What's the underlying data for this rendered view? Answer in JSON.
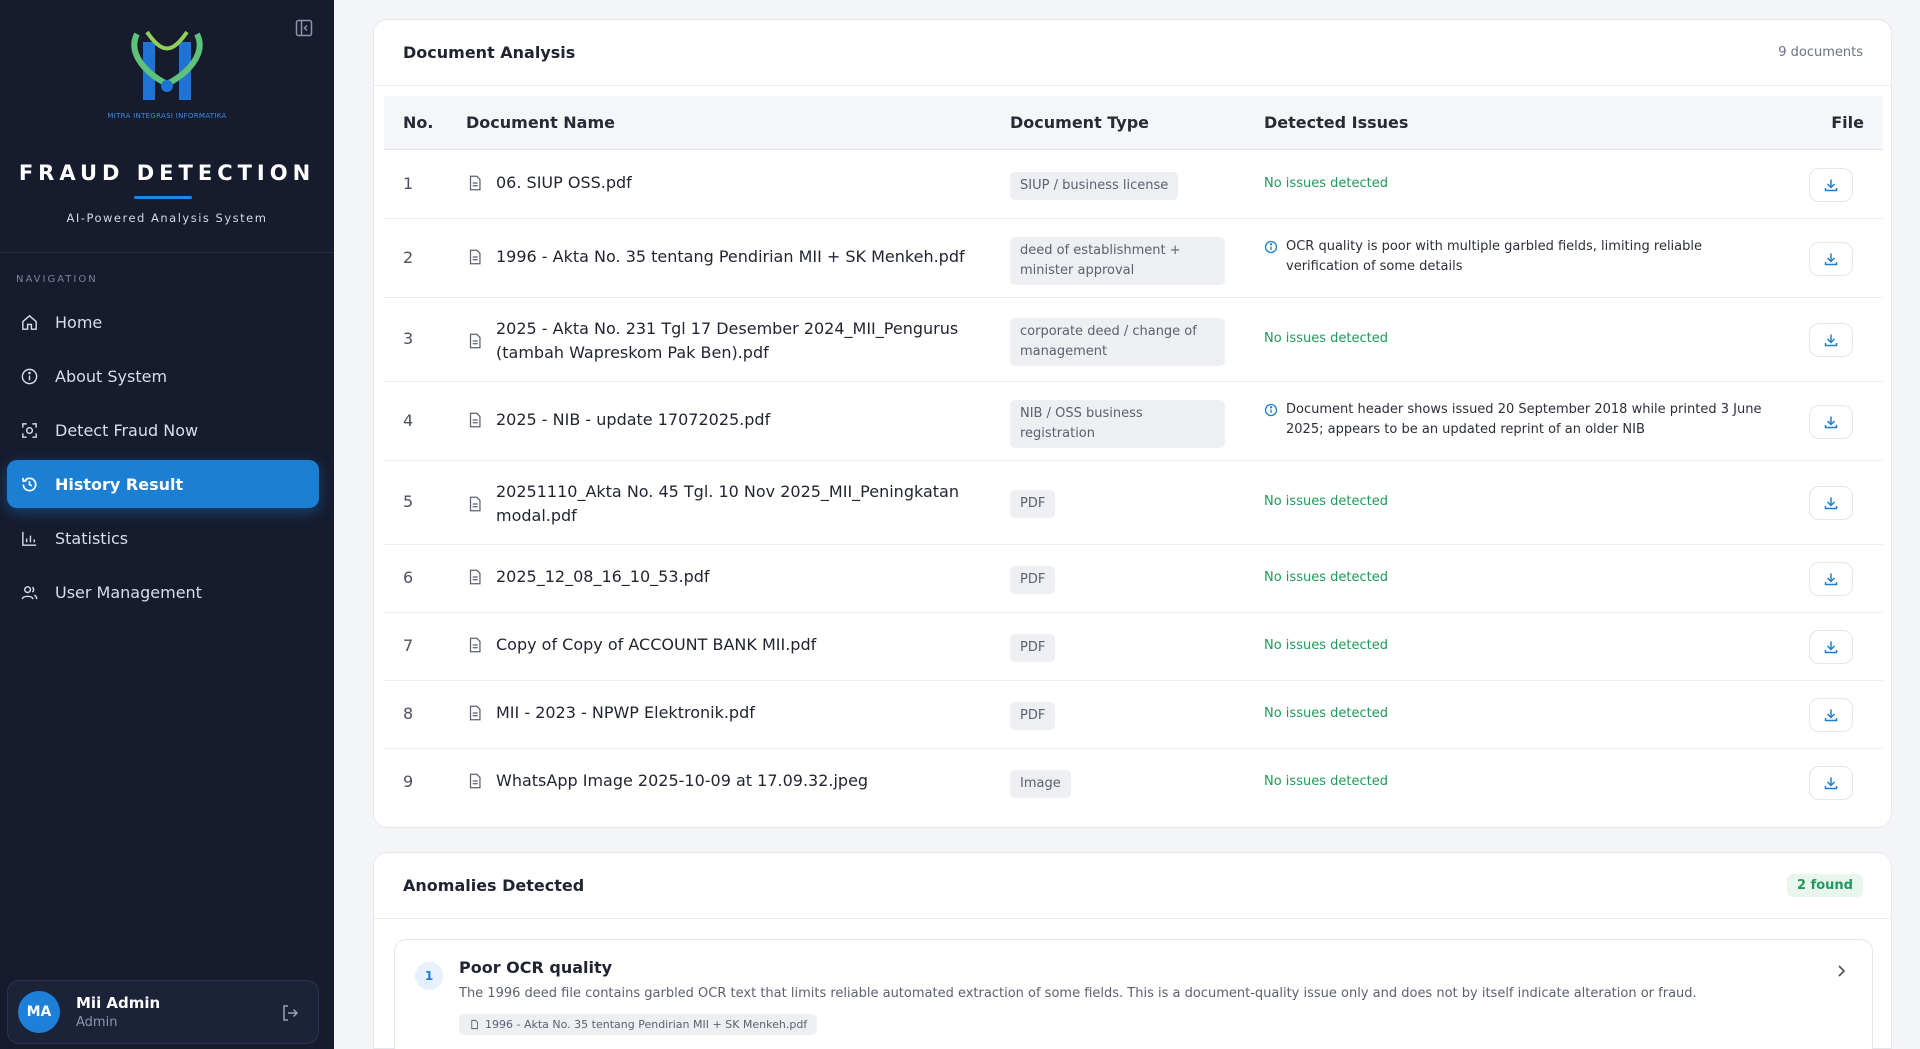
{
  "app": {
    "logo_caption": "MITRA INTEGRASI INFORMATIKA",
    "title": "FRAUD DETECTION",
    "subtitle": "AI-Powered Analysis System"
  },
  "sidebar": {
    "nav_heading": "NAVIGATION",
    "items": [
      {
        "label": "Home",
        "icon": "home-icon",
        "active": false
      },
      {
        "label": "About System",
        "icon": "info-icon",
        "active": false
      },
      {
        "label": "Detect Fraud Now",
        "icon": "scan-icon",
        "active": false
      },
      {
        "label": "History Result",
        "icon": "history-icon",
        "active": true
      },
      {
        "label": "Statistics",
        "icon": "chart-icon",
        "active": false
      },
      {
        "label": "User Management",
        "icon": "users-icon",
        "active": false
      }
    ],
    "user": {
      "initials": "MA",
      "name": "Mii Admin",
      "role": "Admin"
    }
  },
  "analysis": {
    "title": "Document Analysis",
    "count": "9 documents",
    "headers": {
      "no": "No.",
      "name": "Document Name",
      "type": "Document Type",
      "issues": "Detected Issues",
      "file": "File"
    },
    "rows": [
      {
        "no": "1",
        "name": "06. SIUP OSS.pdf",
        "type": "SIUP / business license",
        "issue": "No issues detected",
        "warn": false
      },
      {
        "no": "2",
        "name": "1996 - Akta No. 35 tentang Pendirian MII + SK Menkeh.pdf",
        "type": "deed of establishment + minister approval",
        "issue": "OCR quality is poor with multiple garbled fields, limiting reliable verification of some details",
        "warn": true
      },
      {
        "no": "3",
        "name": "2025 - Akta No. 231 Tgl 17 Desember 2024_MII_Pengurus (tambah Wapreskom Pak Ben).pdf",
        "type": "corporate deed / change of management",
        "issue": "No issues detected",
        "warn": false
      },
      {
        "no": "4",
        "name": "2025 - NIB - update 17072025.pdf",
        "type": "NIB / OSS business registration",
        "issue": "Document header shows issued 20 September 2018 while printed 3 June 2025; appears to be an updated reprint of an older NIB",
        "warn": true
      },
      {
        "no": "5",
        "name": "20251110_Akta No. 45 Tgl. 10 Nov 2025_MII_Peningkatan modal.pdf",
        "type": "PDF",
        "issue": "No issues detected",
        "warn": false
      },
      {
        "no": "6",
        "name": "2025_12_08_16_10_53.pdf",
        "type": "PDF",
        "issue": "No issues detected",
        "warn": false
      },
      {
        "no": "7",
        "name": "Copy of Copy of ACCOUNT BANK MII.pdf",
        "type": "PDF",
        "issue": "No issues detected",
        "warn": false
      },
      {
        "no": "8",
        "name": "MII - 2023 - NPWP Elektronik.pdf",
        "type": "PDF",
        "issue": "No issues detected",
        "warn": false
      },
      {
        "no": "9",
        "name": "WhatsApp Image 2025-10-09 at 17.09.32.jpeg",
        "type": "Image",
        "issue": "No issues detected",
        "warn": false
      }
    ]
  },
  "anomalies": {
    "title": "Anomalies Detected",
    "badge": "2 found",
    "items": [
      {
        "num": "1",
        "title": "Poor OCR quality",
        "description": "The 1996 deed file contains garbled OCR text that limits reliable automated extraction of some fields. This is a document-quality issue only and does not by itself indicate alteration or fraud.",
        "file": "1996 - Akta No. 35 tentang Pendirian MII + SK Menkeh.pdf"
      }
    ]
  },
  "colors": {
    "accent": "#1b7fd3",
    "sidebar_bg": "#161b2e",
    "success": "#1f9a5a"
  }
}
